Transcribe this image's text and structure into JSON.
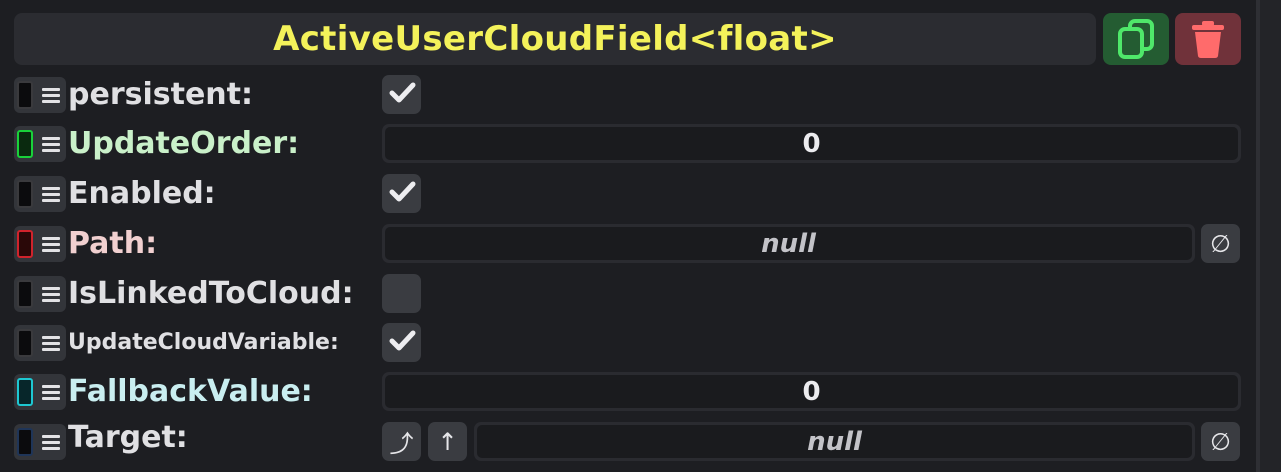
{
  "header": {
    "title": "ActiveUserCloudField<float>",
    "duplicate_icon": "duplicate-icon",
    "delete_icon": "trash-icon"
  },
  "colors": {
    "title": "#f4f25a",
    "duplicate_bg": "#245c32",
    "delete_bg": "#70323a",
    "slot_green": "#19d23a",
    "slot_red": "#d0232c",
    "slot_cyan": "#1ec8d2"
  },
  "fields": [
    {
      "label": "persistent:",
      "type": "checkbox",
      "checked": true
    },
    {
      "label": "UpdateOrder:",
      "type": "number",
      "value": "0"
    },
    {
      "label": "Enabled:",
      "type": "checkbox",
      "checked": true
    },
    {
      "label": "Path:",
      "type": "reference",
      "value": "null"
    },
    {
      "label": "IsLinkedToCloud:",
      "type": "checkbox",
      "checked": false
    },
    {
      "label": "UpdateCloudVariable:",
      "type": "checkbox",
      "checked": true
    },
    {
      "label": "FallbackValue:",
      "type": "number",
      "value": "0"
    },
    {
      "label": "Target:",
      "type": "reference",
      "value": "null",
      "buttons": [
        "⤴",
        "↑"
      ]
    }
  ],
  "clear_symbol": "∅",
  "check_symbol": "✔"
}
